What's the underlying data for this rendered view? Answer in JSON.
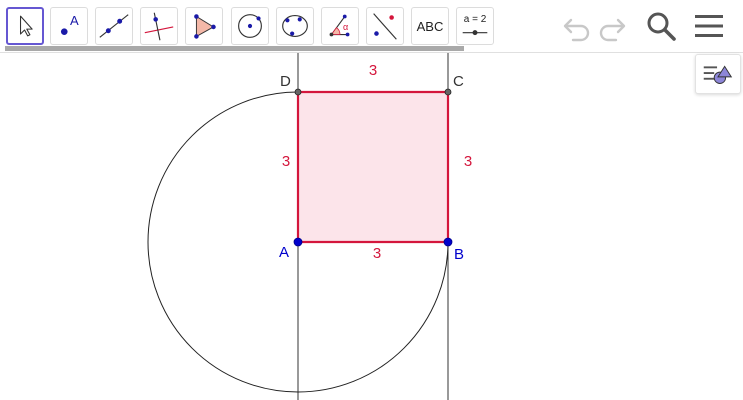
{
  "toolbar": {
    "tools": [
      {
        "id": "move",
        "icon": "cursor-arrow-icon"
      },
      {
        "id": "point",
        "icon": "point-icon",
        "label": "A"
      },
      {
        "id": "line",
        "icon": "line-through-two-points-icon"
      },
      {
        "id": "perpendicular",
        "icon": "perpendicular-line-icon"
      },
      {
        "id": "polygon",
        "icon": "polygon-icon"
      },
      {
        "id": "circle-center-point",
        "icon": "circle-center-point-icon"
      },
      {
        "id": "circle-three-points",
        "icon": "circle-three-points-icon"
      },
      {
        "id": "angle",
        "icon": "angle-icon",
        "label": "α"
      },
      {
        "id": "reflect",
        "icon": "reflect-about-line-icon"
      },
      {
        "id": "text",
        "icon": "text-icon",
        "label": "ABC"
      },
      {
        "id": "slider",
        "icon": "slider-icon",
        "label": "a = 2"
      }
    ],
    "active_tool": "move",
    "undo_icon": "undo-icon",
    "redo_icon": "redo-icon",
    "search_icon": "search-icon",
    "menu_icon": "hamburger-menu-icon",
    "loading_progress": 0.62
  },
  "style_bar": {
    "icon": "style-bar-toggle-icon"
  },
  "geometry": {
    "points": {
      "A": {
        "label": "A",
        "color": "#0000cc"
      },
      "B": {
        "label": "B",
        "color": "#0000cc"
      },
      "C": {
        "label": "C",
        "color": "#333333"
      },
      "D": {
        "label": "D",
        "color": "#333333"
      }
    },
    "segments": {
      "AB": "3",
      "BC": "3",
      "CD": "3",
      "DA": "3"
    },
    "colors": {
      "square_stroke": "#d4163c",
      "square_fill": "#fce4ea",
      "segment_label": "#d4163c",
      "lines": "#333333",
      "free_point": "#0000cc"
    }
  }
}
